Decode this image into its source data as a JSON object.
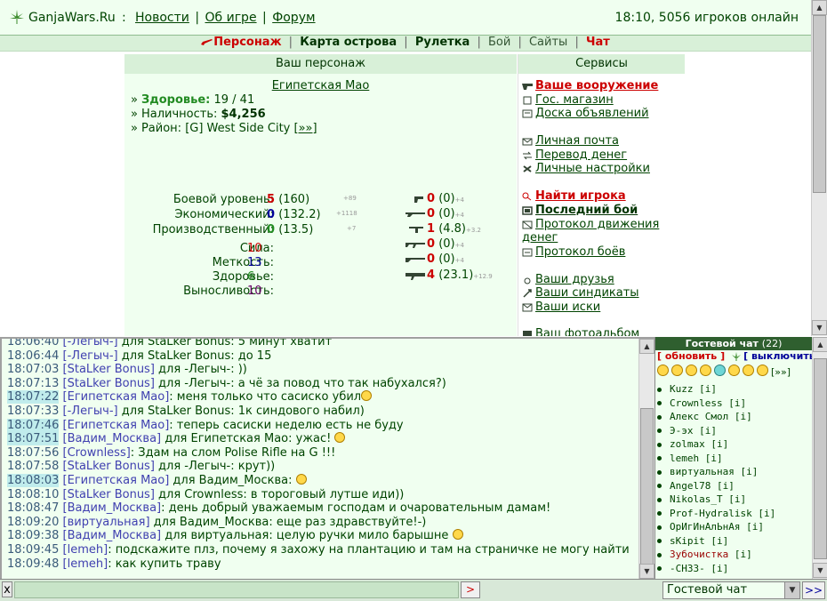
{
  "header": {
    "site_name": "GanjaWars.Ru",
    "separator": ":",
    "links": [
      "Новости",
      "Об игре",
      "Форум"
    ],
    "link_sep": "|",
    "status": "18:10, 5056 игроков онлайн"
  },
  "menu": {
    "items": [
      "Персонаж",
      "Карта острова",
      "Рулетка",
      "Бой",
      "Сайты",
      "Чат"
    ],
    "sep": "|"
  },
  "character": {
    "panel_title": "Ваш персонаж",
    "name": "Египетская Мао",
    "health_label": "Здоровье:",
    "health_value": "19 / 41",
    "cash_label": "Наличность:",
    "cash_value": "$4,256",
    "district_label": "Район:",
    "district_value": "[G] West Side City",
    "district_more": "[»»]",
    "levels": [
      {
        "label": "Боевой уровень:",
        "value": "5",
        "extra": "(160)",
        "inc": "+89",
        "color": "#cc0000"
      },
      {
        "label": "Экономический:",
        "value": "0",
        "extra": "(132.2)",
        "inc": "+1118",
        "color": "#000099"
      },
      {
        "label": "Производственный:",
        "value": "0",
        "extra": "(13.5)",
        "inc": "+7",
        "color": "#228b22"
      }
    ],
    "attributes": [
      {
        "label": "Сила:",
        "value": "10",
        "color": "#cc0000"
      },
      {
        "label": "Меткость:",
        "value": "13",
        "color": "#000099"
      },
      {
        "label": "Здоровье:",
        "value": "6",
        "color": "#228b22"
      },
      {
        "label": "Выносливость:",
        "value": "10",
        "color": "#660066"
      }
    ],
    "weapons": [
      {
        "icon": "pistol-icon",
        "value": "0",
        "extra": "(0)",
        "inc": "+4",
        "color": "#cc0000"
      },
      {
        "icon": "shotgun-icon",
        "value": "0",
        "extra": "(0)",
        "inc": "+4",
        "color": "#cc0000"
      },
      {
        "icon": "smg-icon",
        "value": "1",
        "extra": "(4.8)",
        "inc": "+3.2",
        "color": "#cc0000"
      },
      {
        "icon": "machinegun-icon",
        "value": "0",
        "extra": "(0)",
        "inc": "+4",
        "color": "#cc0000"
      },
      {
        "icon": "rifle-icon",
        "value": "0",
        "extra": "(0)",
        "inc": "+4",
        "color": "#cc0000"
      },
      {
        "icon": "heavy-icon",
        "value": "4",
        "extra": "(23.1)",
        "inc": "+12.9",
        "color": "#cc0000"
      }
    ]
  },
  "services": {
    "panel_title": "Сервисы",
    "items": [
      {
        "label": "Ваше вооружение",
        "style": "red",
        "icon": "gun-icon"
      },
      {
        "label": "Гос. магазин",
        "style": "",
        "icon": "shop-icon"
      },
      {
        "label": "Доска объявлений",
        "style": "",
        "icon": "board-icon"
      },
      {
        "label": "Личная почта",
        "style": "",
        "icon": "mail-icon"
      },
      {
        "label": "Перевод денег",
        "style": "",
        "icon": "money-transfer-icon"
      },
      {
        "label": "Личные настройки",
        "style": "",
        "icon": "settings-icon"
      },
      {
        "label": "Найти игрока",
        "style": "red",
        "icon": "search-icon"
      },
      {
        "label": "Последний бой",
        "style": "bold",
        "icon": "battle-icon"
      },
      {
        "label": "Протокол движения денег",
        "style": "",
        "icon": "protocol-icon"
      },
      {
        "label": "Протокол боёв",
        "style": "",
        "icon": "battles-log-icon"
      },
      {
        "label": "Ваши друзья",
        "style": "",
        "icon": "friends-icon"
      },
      {
        "label": "Ваши синдикаты",
        "style": "",
        "icon": "syndicate-icon"
      },
      {
        "label": "Ваши иски",
        "style": "",
        "icon": "claims-icon"
      },
      {
        "label": "Ваш фотоальбом",
        "style": "",
        "icon": "photo-icon"
      }
    ]
  },
  "chat": {
    "lines": [
      {
        "ts": "18:06:40",
        "hl": false,
        "nick": "[-Легыч-]",
        "text": " для StaLker Bonus: 5 минут хватит",
        "smiley": false
      },
      {
        "ts": "18:06:44",
        "hl": false,
        "nick": "[-Легыч-]",
        "text": " для StaLker Bonus: до 15",
        "smiley": false
      },
      {
        "ts": "18:07:03",
        "hl": false,
        "nick": "[StaLker Bonus]",
        "text": " для -Легыч-: ))",
        "smiley": false
      },
      {
        "ts": "18:07:13",
        "hl": false,
        "nick": "[StaLker Bonus]",
        "text": " для -Легыч-: а чё за повод что так набухался?)",
        "smiley": false
      },
      {
        "ts": "18:07:22",
        "hl": true,
        "nick": "[Египетская Мао]",
        "text": ": меня только что сасиско убил",
        "smiley": true
      },
      {
        "ts": "18:07:33",
        "hl": false,
        "nick": "[-Легыч-]",
        "text": " для StaLker Bonus: 1к синдового набил)",
        "smiley": false
      },
      {
        "ts": "18:07:46",
        "hl": true,
        "nick": "[Египетская Мао]",
        "text": ": теперь сасиски неделю есть не буду",
        "smiley": false
      },
      {
        "ts": "18:07:51",
        "hl": true,
        "nick": "[Вадим_Москва]",
        "text": " для Египетская Мао: ужас! ",
        "smiley": true
      },
      {
        "ts": "18:07:56",
        "hl": false,
        "nick": "[Crownless]",
        "text": ": Здам на слом Polise Rifle на G !!!",
        "smiley": false
      },
      {
        "ts": "18:07:58",
        "hl": false,
        "nick": "[StaLker Bonus]",
        "text": " для -Легыч-: крут))",
        "smiley": false
      },
      {
        "ts": "18:08:03",
        "hl": true,
        "nick": "[Египетская Мао]",
        "text": " для Вадим_Москва: ",
        "smiley": true
      },
      {
        "ts": "18:08:10",
        "hl": false,
        "nick": "[StaLker Bonus]",
        "text": " для Crownless: в тороговый лутше иди))",
        "smiley": false
      },
      {
        "ts": "18:08:47",
        "hl": false,
        "nick": "[Вадим_Москва]",
        "text": ": день добрый уважаемым господам и очаровательным дамам!",
        "smiley": false
      },
      {
        "ts": "18:09:20",
        "hl": false,
        "nick": "[виртуальная]",
        "text": " для Вадим_Москва: еще раз здравствуйте!-)",
        "smiley": false
      },
      {
        "ts": "18:09:38",
        "hl": false,
        "nick": "[Вадим_Москва]",
        "text": " для виртуальная: целую ручки мило барышне ",
        "smiley": true
      },
      {
        "ts": "18:09:45",
        "hl": false,
        "nick": "[lemeh]",
        "text": ": подскажите плз, почему я захожу на плантацию и там на страничке не могу найти",
        "smiley": false
      },
      {
        "ts": "18:09:48",
        "hl": false,
        "nick": "[lemeh]",
        "text": ": как купить траву",
        "smiley": false
      }
    ]
  },
  "guest_chat": {
    "title": "Гостевой чат",
    "count": "(22)",
    "refresh": "[ обновить ]",
    "toggle_off": "[ выключить ]",
    "more": "[»»]",
    "info_tag": "[i]",
    "users": [
      {
        "name": "Kuzz",
        "red": false
      },
      {
        "name": "Crownless",
        "red": false
      },
      {
        "name": "Алекс Смол",
        "red": false
      },
      {
        "name": "Э-эх",
        "red": false
      },
      {
        "name": "zolmax",
        "red": false
      },
      {
        "name": "lemeh",
        "red": false
      },
      {
        "name": "виртуальная",
        "red": false
      },
      {
        "name": "Angel78",
        "red": false
      },
      {
        "name": "Nikolas_T",
        "red": false
      },
      {
        "name": "Prof-Hydralisk",
        "red": false
      },
      {
        "name": "ОрИгИнАлЬнАя",
        "red": false
      },
      {
        "name": "sKipit",
        "red": false
      },
      {
        "name": "Зубочистка",
        "red": true
      },
      {
        "name": "-СН33-",
        "red": false
      }
    ]
  },
  "bottom": {
    "close": "x",
    "send": ">",
    "channel": "Гостевой чат",
    "go": ">>"
  }
}
